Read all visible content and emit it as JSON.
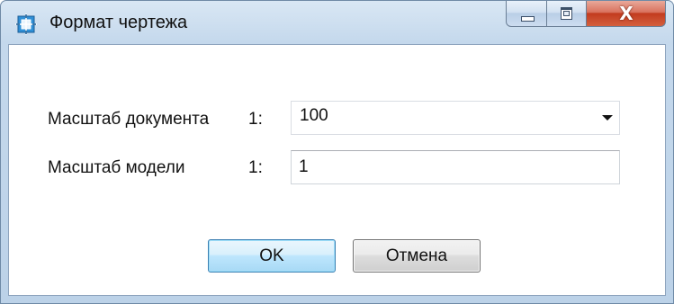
{
  "window": {
    "title": "Формат чертежа",
    "icon": "drawing-format-icon",
    "controls": {
      "minimize_icon": "minimize-icon",
      "maximize_icon": "maximize-icon",
      "close_icon": "close-icon",
      "close_glyph": "X"
    }
  },
  "form": {
    "document_scale": {
      "label": "Масштаб документа",
      "prefix": "1:",
      "value": "100"
    },
    "model_scale": {
      "label": "Масштаб модели",
      "prefix": "1:",
      "value": "1"
    }
  },
  "buttons": {
    "ok_label": "OK",
    "cancel_label": "Отмена"
  },
  "colors": {
    "title_accent": "#bcd2e8",
    "close_button": "#c23b1f",
    "default_button_border": "#3c7fb1"
  }
}
